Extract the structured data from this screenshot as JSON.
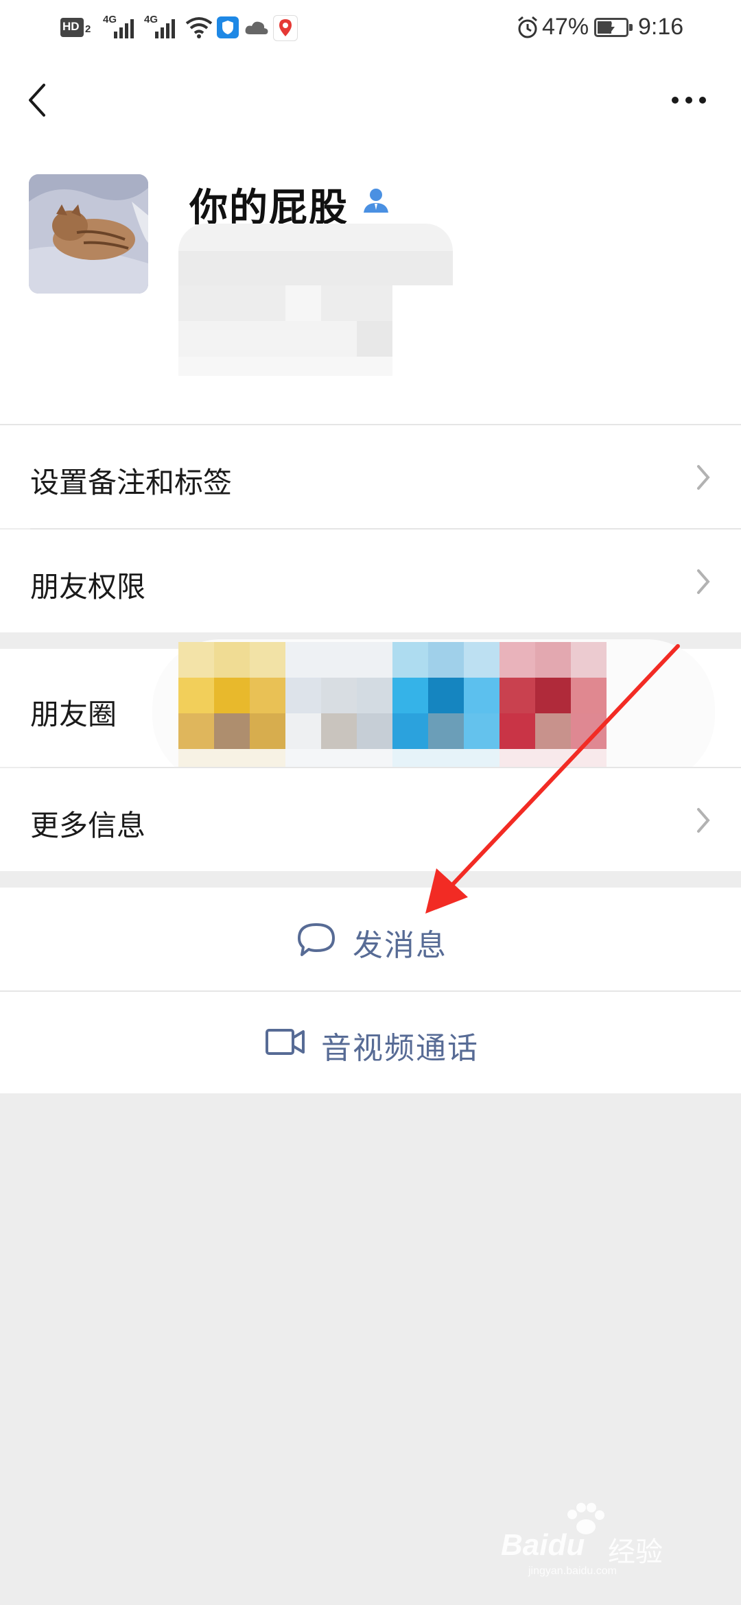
{
  "status_bar": {
    "hd_label": "HD",
    "hd_sub": "2",
    "network1": "4G",
    "network2": "4G",
    "battery_percent": "47%",
    "time": "9:16",
    "icons": [
      "hd-icon",
      "signal-icon",
      "signal-icon",
      "wifi-icon",
      "shield-app-icon",
      "cloud-icon",
      "map-pin-app-icon",
      "alarm-icon",
      "battery-charging-icon"
    ]
  },
  "header": {
    "back_icon": "chevron-left-icon",
    "more_icon": "more-dots-icon"
  },
  "profile": {
    "name": "你的屁股",
    "badge_icon": "contact-person-icon"
  },
  "menu": {
    "remark_tags": "设置备注和标签",
    "friend_permissions": "朋友权限",
    "moments": "朋友圈",
    "more_info": "更多信息"
  },
  "actions": {
    "send_message": "发消息",
    "video_call": "音视频通话"
  },
  "watermark": {
    "brand": "Baidu",
    "cn": "经验",
    "url": "jingyan.baidu.com"
  },
  "colors": {
    "link_blue": "#576b95",
    "background_gray": "#ededed",
    "annotation_red": "#f22b24"
  }
}
